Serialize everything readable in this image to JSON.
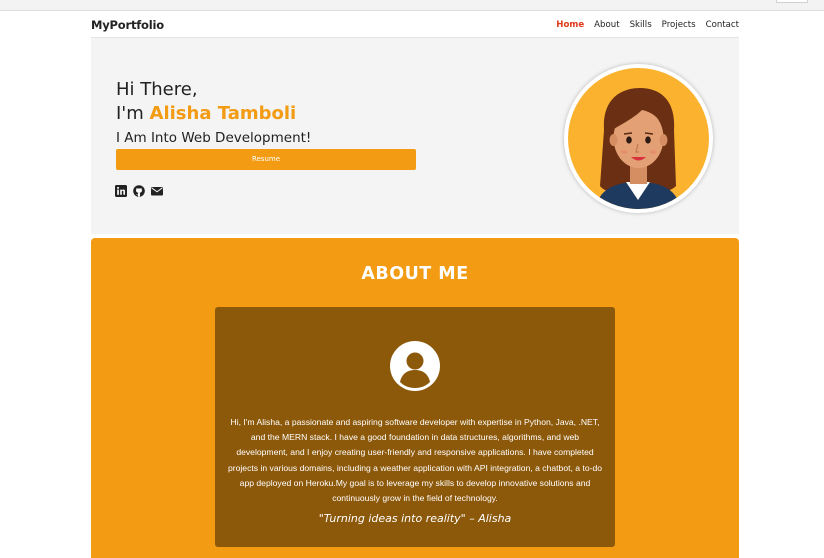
{
  "navbar": {
    "brand": "MyPortfolio",
    "links": [
      {
        "label": "Home",
        "active": true
      },
      {
        "label": "About",
        "active": false
      },
      {
        "label": "Skills",
        "active": false
      },
      {
        "label": "Projects",
        "active": false
      },
      {
        "label": "Contact",
        "active": false
      }
    ]
  },
  "hero": {
    "greeting": "Hi There,",
    "name_prefix": "I'm",
    "name": "Alisha Tamboli",
    "role": "I Am Into Web Development!",
    "resume_label": "Resume",
    "socials": [
      "linkedin-icon",
      "github-icon",
      "envelope-icon"
    ],
    "avatar": "cartoon-girl-avatar"
  },
  "about": {
    "title": "ABOUT ME",
    "icon": "user-circle-icon",
    "text": "Hi, I'm Alisha, a passionate and aspiring software developer with expertise in Python, Java, .NET, and the MERN stack. I have a good foundation in data structures, algorithms, and web development, and I enjoy creating user-friendly and responsive applications. I have completed projects in various domains, including a weather application with API integration, a chatbot, a to-do app deployed on Heroku.My goal is to leverage my skills to develop innovative solutions and continuously grow in the field of technology.",
    "quote": "\"Turning ideas into reality\" – Alisha"
  },
  "colors": {
    "accent": "#f29b13",
    "active_link": "#e0391c",
    "card": "#8c5809",
    "hero_bg": "#f4f4f4"
  }
}
